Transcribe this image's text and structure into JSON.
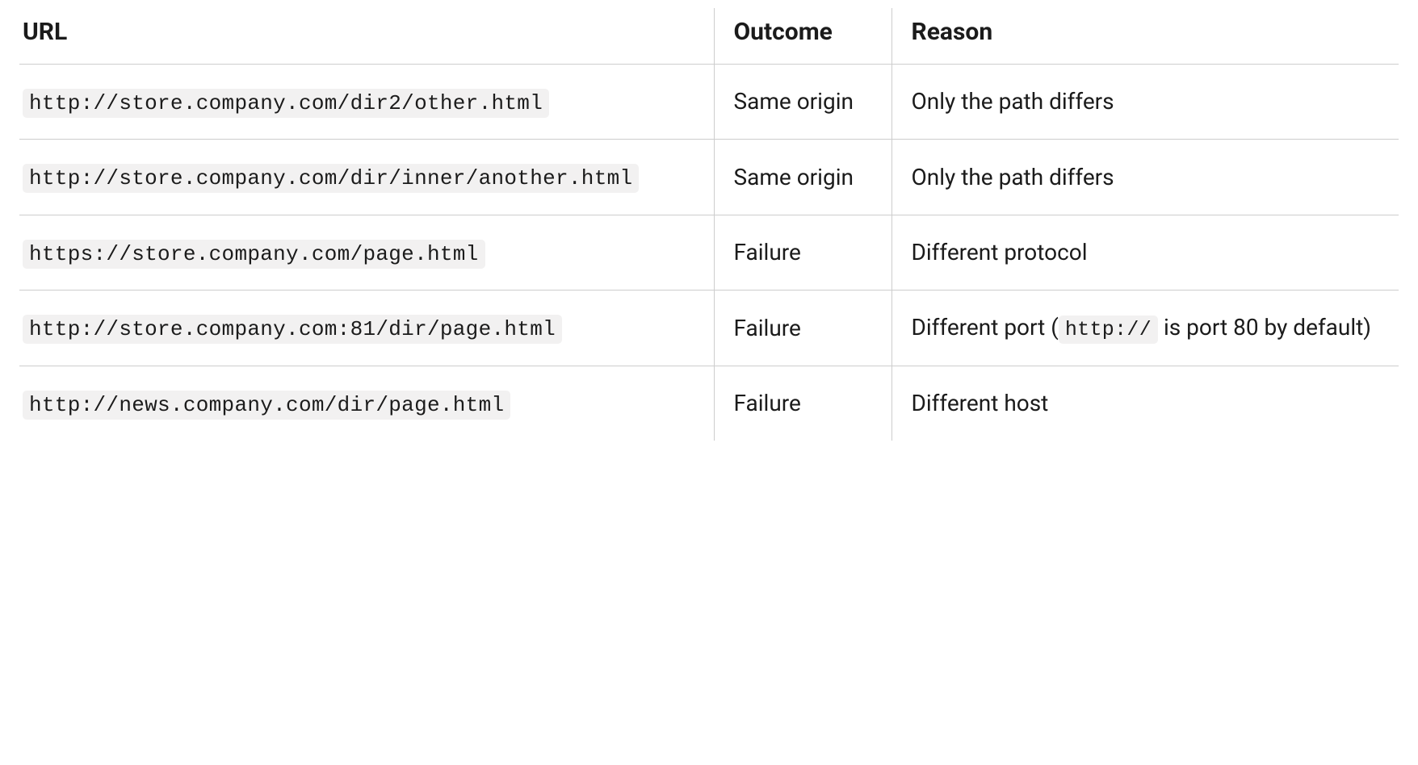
{
  "table": {
    "headers": {
      "url": "URL",
      "outcome": "Outcome",
      "reason": "Reason"
    },
    "rows": [
      {
        "url": "http://store.company.com/dir2/other.html",
        "outcome": "Same origin",
        "reason": {
          "type": "text",
          "text": "Only the path differs"
        }
      },
      {
        "url": "http://store.company.com/dir/inner/another.html",
        "outcome": "Same origin",
        "reason": {
          "type": "text",
          "text": "Only the path differs"
        }
      },
      {
        "url": "https://store.company.com/page.html",
        "outcome": "Failure",
        "reason": {
          "type": "text",
          "text": "Different protocol"
        }
      },
      {
        "url": "http://store.company.com:81/dir/page.html",
        "outcome": "Failure",
        "reason": {
          "type": "mixed",
          "pre": "Different port (",
          "code": "http://",
          "post": " is port 80 by default)"
        }
      },
      {
        "url": "http://news.company.com/dir/page.html",
        "outcome": "Failure",
        "reason": {
          "type": "text",
          "text": "Different host"
        }
      }
    ]
  }
}
